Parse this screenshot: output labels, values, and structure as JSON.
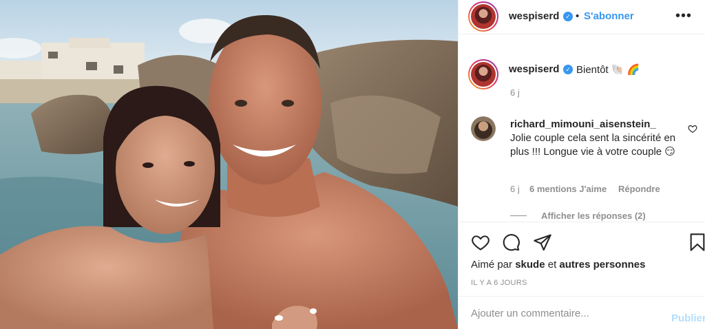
{
  "post": {
    "username": "wespiserd",
    "verified_mark": "✓",
    "separator": "•",
    "follow_label": "S'abonner",
    "more_label": "•••",
    "caption": {
      "username": "wespiserd",
      "text": "Bientôt 🐚 🌈",
      "age": "6 j"
    },
    "comments": [
      {
        "username": "richard_mimouni_aisenstein_",
        "text": "Jolie couple cela sent la sincérité en plus !!! Longue vie à votre couple 😏",
        "age": "6 j",
        "likes": "6 mentions J'aime",
        "reply_label": "Répondre",
        "view_replies": "Afficher les réponses (2)"
      }
    ],
    "liked_by": {
      "prefix": "Aimé par",
      "user": "skude",
      "conjunction": "et",
      "others": "autres personnes"
    },
    "timestamp": "Il y a 6 jours",
    "add_comment_placeholder": "Ajouter un commentaire...",
    "publish_label": "Publier"
  },
  "icons": {
    "like": "heart-icon",
    "comment": "comment-icon",
    "share": "share-icon",
    "save": "bookmark-icon"
  },
  "colors": {
    "link_blue": "#3897f0",
    "publish_disabled": "#b2dffc",
    "muted": "#8e8e8e",
    "text": "#262626",
    "border": "#efefef"
  }
}
